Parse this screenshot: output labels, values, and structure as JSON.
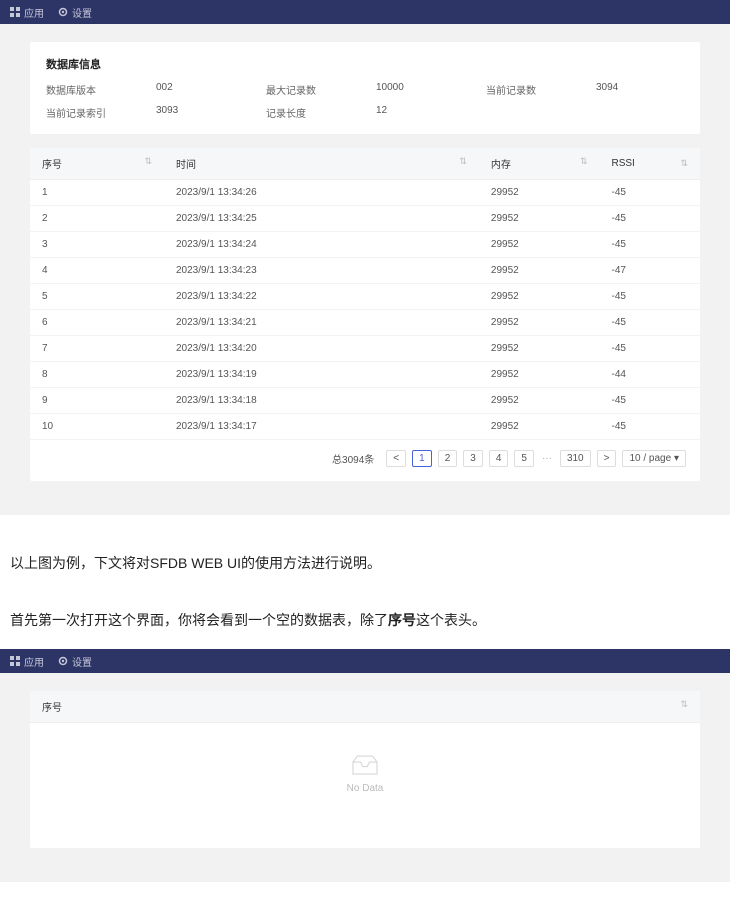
{
  "nav": {
    "items": [
      {
        "icon": "grid-icon",
        "label": "应用"
      },
      {
        "icon": "gear-icon",
        "label": "设置"
      }
    ]
  },
  "info_card": {
    "title": "数据库信息",
    "rows": [
      {
        "k1": "数据库版本",
        "v1": "002",
        "k2": "最大记录数",
        "v2": "10000",
        "k3": "当前记录数",
        "v3": "3094"
      },
      {
        "k1": "当前记录索引",
        "v1": "3093",
        "k2": "记录长度",
        "v2": "12",
        "k3": "",
        "v3": ""
      }
    ]
  },
  "table": {
    "headers": {
      "idx": "序号",
      "time": "时间",
      "mem": "内存",
      "rssi": "RSSI"
    },
    "rows": [
      {
        "idx": "1",
        "time": "2023/9/1 13:34:26",
        "mem": "29952",
        "rssi": "-45"
      },
      {
        "idx": "2",
        "time": "2023/9/1 13:34:25",
        "mem": "29952",
        "rssi": "-45"
      },
      {
        "idx": "3",
        "time": "2023/9/1 13:34:24",
        "mem": "29952",
        "rssi": "-45"
      },
      {
        "idx": "4",
        "time": "2023/9/1 13:34:23",
        "mem": "29952",
        "rssi": "-47"
      },
      {
        "idx": "5",
        "time": "2023/9/1 13:34:22",
        "mem": "29952",
        "rssi": "-45"
      },
      {
        "idx": "6",
        "time": "2023/9/1 13:34:21",
        "mem": "29952",
        "rssi": "-45"
      },
      {
        "idx": "7",
        "time": "2023/9/1 13:34:20",
        "mem": "29952",
        "rssi": "-45"
      },
      {
        "idx": "8",
        "time": "2023/9/1 13:34:19",
        "mem": "29952",
        "rssi": "-44"
      },
      {
        "idx": "9",
        "time": "2023/9/1 13:34:18",
        "mem": "29952",
        "rssi": "-45"
      },
      {
        "idx": "10",
        "time": "2023/9/1 13:34:17",
        "mem": "29952",
        "rssi": "-45"
      }
    ]
  },
  "pager": {
    "total_label": "总3094条",
    "prev": "<",
    "pages": [
      "1",
      "2",
      "3",
      "4",
      "5"
    ],
    "ellipsis": "···",
    "last": "310",
    "next": ">",
    "size_label": "10 / page"
  },
  "doc": {
    "para1_a": "以上图为例，下文将对SFDB WEB UI的使用方法进行说明。",
    "para2_a": "首先第一次打开这个界面，你将会看到一个空的数据表，除了",
    "para2_b": "序号",
    "para2_c": "这个表头。"
  },
  "empty_table": {
    "header": "序号",
    "empty_text": "No Data"
  }
}
